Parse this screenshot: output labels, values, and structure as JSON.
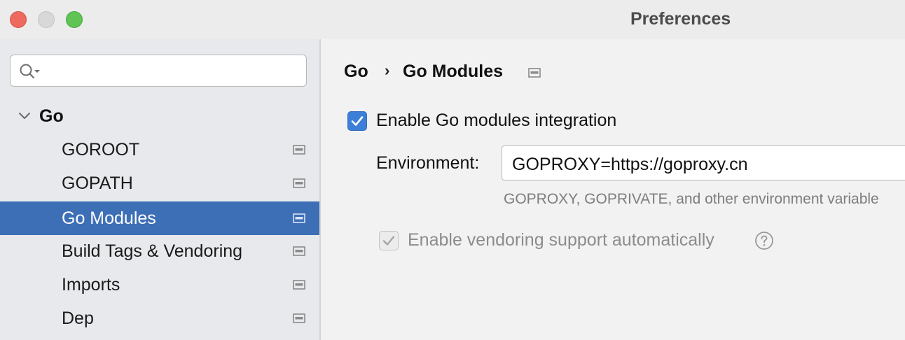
{
  "window": {
    "title": "Preferences"
  },
  "sidebar": {
    "search": {
      "value": "",
      "placeholder": ""
    },
    "root": {
      "label": "Go",
      "expanded": true
    },
    "items": [
      {
        "label": "GOROOT",
        "selected": false,
        "icon": "project-settings-icon"
      },
      {
        "label": "GOPATH",
        "selected": false,
        "icon": "project-settings-icon"
      },
      {
        "label": "Go Modules",
        "selected": true,
        "icon": "project-settings-icon"
      },
      {
        "label": "Build Tags & Vendoring",
        "selected": false,
        "icon": "project-settings-icon"
      },
      {
        "label": "Imports",
        "selected": false,
        "icon": "project-settings-icon"
      },
      {
        "label": "Dep",
        "selected": false,
        "icon": "project-settings-icon"
      }
    ]
  },
  "content": {
    "breadcrumb": {
      "parent": "Go",
      "separator": "›",
      "current": "Go Modules"
    },
    "enable_modules": {
      "label": "Enable Go modules integration",
      "checked": true
    },
    "environment": {
      "label": "Environment:",
      "value": "GOPROXY=https://goproxy.cn",
      "hint": "GOPROXY, GOPRIVATE, and other environment variable"
    },
    "vendoring": {
      "label": "Enable vendoring support automatically",
      "checked": true,
      "enabled": false
    }
  },
  "colors": {
    "selection": "#3d6fb6",
    "checkbox_accent": "#3d7fd8",
    "close": "#ee6a5f",
    "minimize": "#d8d8d8",
    "maximize": "#5fc454"
  }
}
